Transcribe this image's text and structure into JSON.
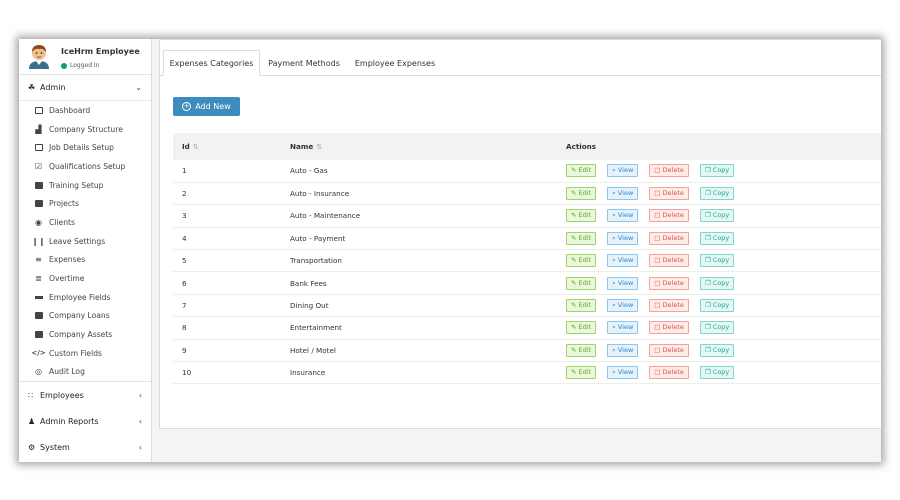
{
  "user": {
    "name": "IceHrm Employee",
    "status": "Logged In"
  },
  "sidebar": {
    "admin_label": "Admin",
    "items": [
      {
        "label": "Dashboard",
        "icon": "desktop-icon"
      },
      {
        "label": "Company Structure",
        "icon": "building-icon"
      },
      {
        "label": "Job Details Setup",
        "icon": "columns-icon"
      },
      {
        "label": "Qualifications Setup",
        "icon": "check-square-icon"
      },
      {
        "label": "Training Setup",
        "icon": "briefcase-icon"
      },
      {
        "label": "Projects",
        "icon": "list-alt-icon"
      },
      {
        "label": "Clients",
        "icon": "user-circle-icon"
      },
      {
        "label": "Leave Settings",
        "icon": "pause-icon"
      },
      {
        "label": "Expenses",
        "icon": "bars-icon"
      },
      {
        "label": "Overtime",
        "icon": "overtime-icon"
      },
      {
        "label": "Employee Fields",
        "icon": "minus-bar-icon"
      },
      {
        "label": "Company Loans",
        "icon": "money-icon"
      },
      {
        "label": "Company Assets",
        "icon": "archive-icon"
      },
      {
        "label": "Custom Fields",
        "icon": "code-icon"
      },
      {
        "label": "Audit Log",
        "icon": "compass-icon"
      }
    ],
    "sections": [
      {
        "label": "Employees"
      },
      {
        "label": "Admin Reports"
      },
      {
        "label": "System"
      }
    ]
  },
  "tabs": [
    {
      "label": "Expenses Categories",
      "active": true
    },
    {
      "label": "Payment Methods",
      "active": false
    },
    {
      "label": "Employee Expenses",
      "active": false
    }
  ],
  "toolbar": {
    "add_label": "Add New"
  },
  "table": {
    "columns": {
      "id": "Id",
      "name": "Name",
      "actions": "Actions"
    },
    "actions": {
      "edit": "Edit",
      "view": "View",
      "delete": "Delete",
      "copy": "Copy"
    },
    "rows": [
      {
        "id": "1",
        "name": "Auto - Gas"
      },
      {
        "id": "2",
        "name": "Auto - Insurance"
      },
      {
        "id": "3",
        "name": "Auto - Maintenance"
      },
      {
        "id": "4",
        "name": "Auto - Payment"
      },
      {
        "id": "5",
        "name": "Transportation"
      },
      {
        "id": "6",
        "name": "Bank Fees"
      },
      {
        "id": "7",
        "name": "Dining Out"
      },
      {
        "id": "8",
        "name": "Entertainment"
      },
      {
        "id": "9",
        "name": "Hotel / Motel"
      },
      {
        "id": "10",
        "name": "Insurance"
      }
    ]
  },
  "colors": {
    "accent": "#3c8dbc",
    "edit": "#5aa81e",
    "view": "#2f86c9",
    "delete": "#e0553f",
    "copy": "#22a695",
    "online": "#00a65a"
  }
}
